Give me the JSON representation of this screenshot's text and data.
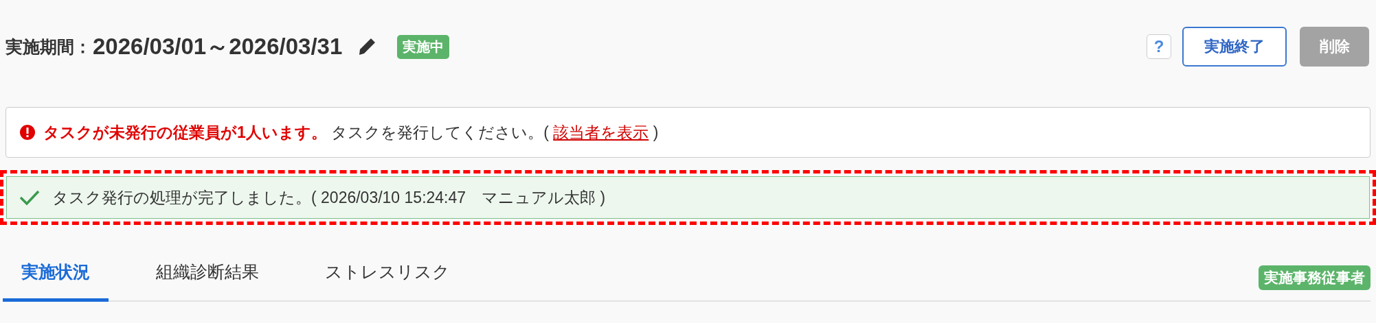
{
  "period": {
    "label": "実施期間：",
    "value": "2026/03/01～2026/03/31",
    "status": "実施中"
  },
  "actions": {
    "help": "?",
    "buttons": [
      {
        "label": "実施終了",
        "disabled": false
      },
      {
        "label": "削除",
        "disabled": true
      }
    ]
  },
  "alert": {
    "kind": "error",
    "message": "**タスクが未発行の従業員が1人います。** タスクを発行してください。( ",
    "link": "該当者を表示",
    "tail": " )"
  },
  "notice": {
    "kind": "success",
    "text": "タスク発行の処理が完了しました。( 2026/03/10 15:24:47　マニュアル太郎 )",
    "highlighted": true
  },
  "tabs": [
    {
      "label": "実施状況",
      "selected": true
    },
    {
      "label": "組織診断結果",
      "selected": false
    },
    {
      "label": "ストレスリスク",
      "selected": false
    }
  ],
  "role_badge": "実施事務従事者"
}
